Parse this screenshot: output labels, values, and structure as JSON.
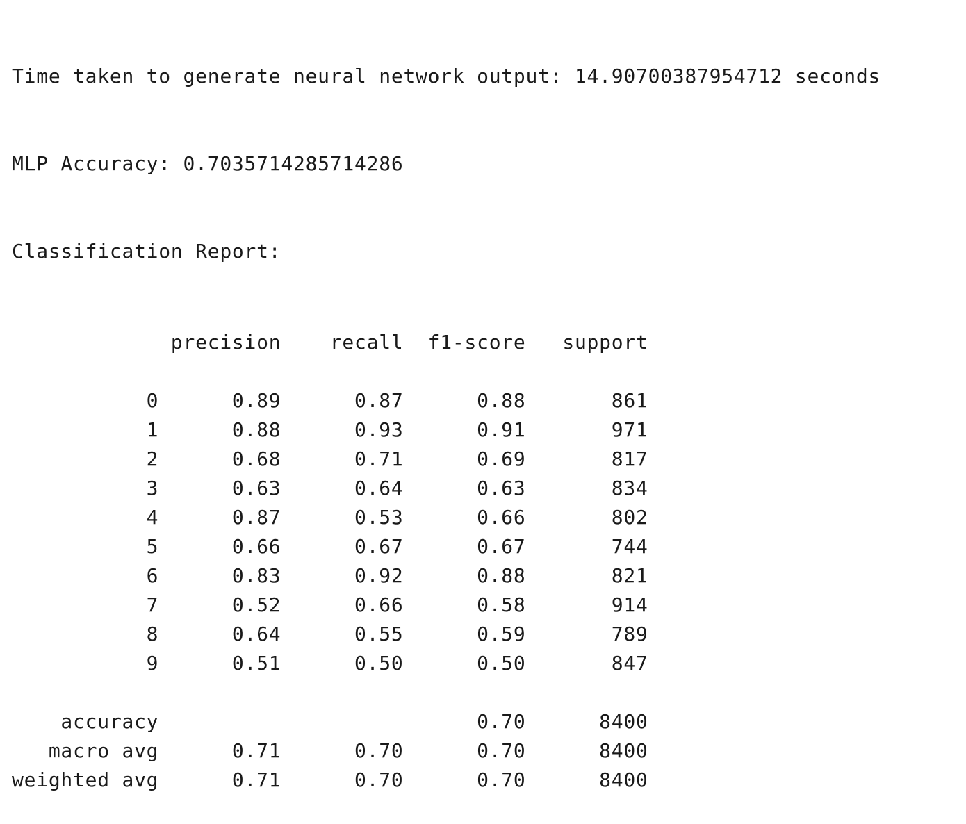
{
  "output": {
    "time_line": "Time taken to generate neural network output: 14.90700387954712 seconds",
    "accuracy_line": "MLP Accuracy: 0.7035714285714286",
    "report_title": "Classification Report:"
  },
  "report": {
    "headers": [
      "precision",
      "recall",
      "f1-score",
      "support"
    ],
    "class_rows": [
      {
        "label": "0",
        "precision": "0.89",
        "recall": "0.87",
        "f1": "0.88",
        "support": "861"
      },
      {
        "label": "1",
        "precision": "0.88",
        "recall": "0.93",
        "f1": "0.91",
        "support": "971"
      },
      {
        "label": "2",
        "precision": "0.68",
        "recall": "0.71",
        "f1": "0.69",
        "support": "817"
      },
      {
        "label": "3",
        "precision": "0.63",
        "recall": "0.64",
        "f1": "0.63",
        "support": "834"
      },
      {
        "label": "4",
        "precision": "0.87",
        "recall": "0.53",
        "f1": "0.66",
        "support": "802"
      },
      {
        "label": "5",
        "precision": "0.66",
        "recall": "0.67",
        "f1": "0.67",
        "support": "744"
      },
      {
        "label": "6",
        "precision": "0.83",
        "recall": "0.92",
        "f1": "0.88",
        "support": "821"
      },
      {
        "label": "7",
        "precision": "0.52",
        "recall": "0.66",
        "f1": "0.58",
        "support": "914"
      },
      {
        "label": "8",
        "precision": "0.64",
        "recall": "0.55",
        "f1": "0.59",
        "support": "789"
      },
      {
        "label": "9",
        "precision": "0.51",
        "recall": "0.50",
        "f1": "0.50",
        "support": "847"
      }
    ],
    "summary_rows": [
      {
        "label": "accuracy",
        "precision": "",
        "recall": "",
        "f1": "0.70",
        "support": "8400"
      },
      {
        "label": "macro avg",
        "precision": "0.71",
        "recall": "0.70",
        "f1": "0.70",
        "support": "8400"
      },
      {
        "label": "weighted avg",
        "precision": "0.71",
        "recall": "0.70",
        "f1": "0.70",
        "support": "8400"
      }
    ]
  }
}
